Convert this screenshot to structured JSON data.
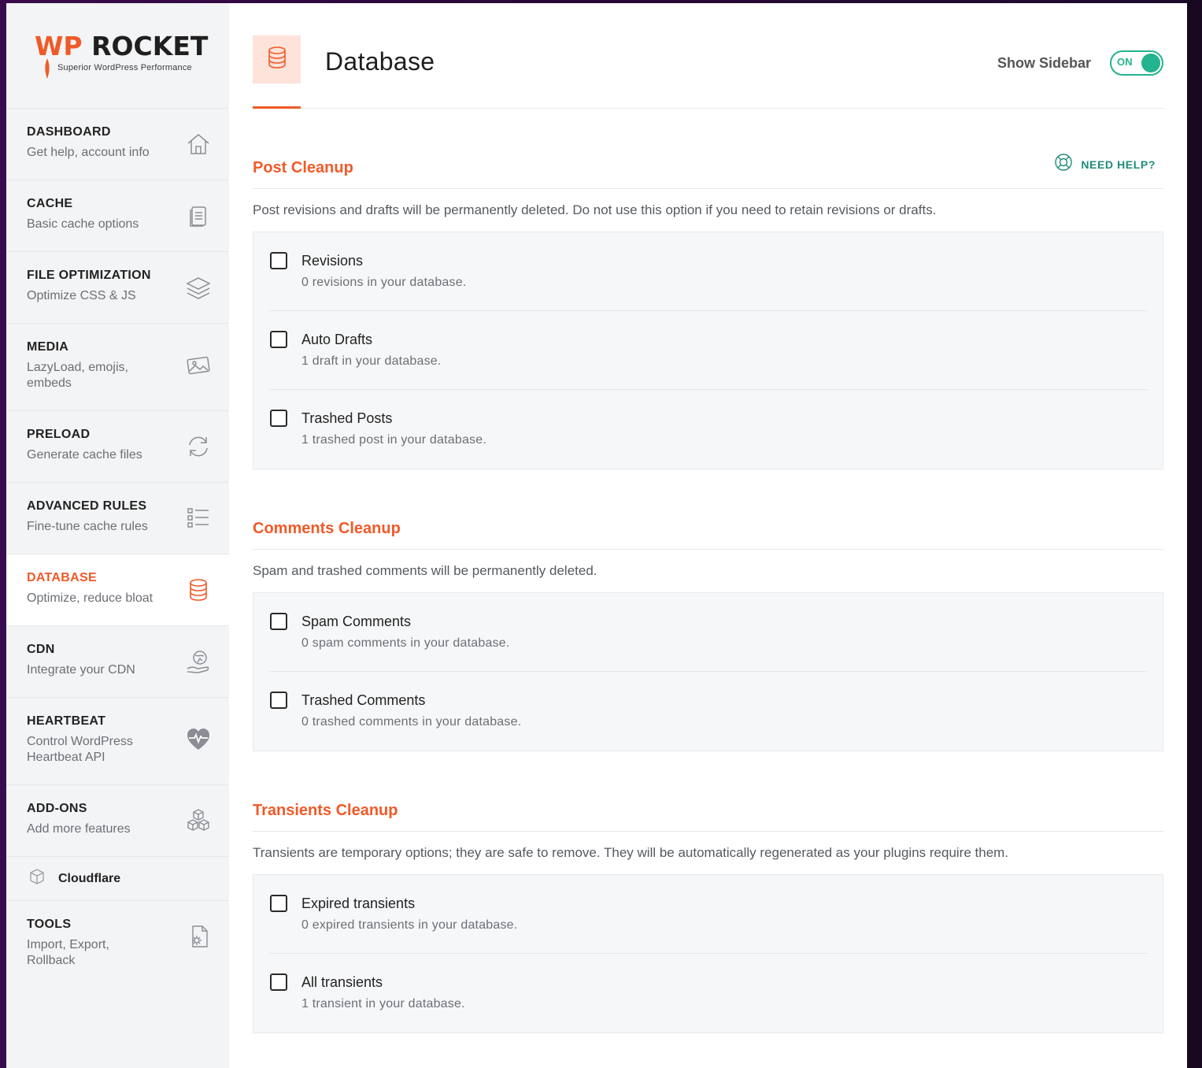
{
  "app": {
    "logo_brand_prefix": "WP",
    "logo_brand_rest": " ROCKET",
    "logo_tagline": "Superior WordPress Performance"
  },
  "colors": {
    "accent": "#f05a28",
    "toggle_on": "#23b38e",
    "help": "#1e8c7a"
  },
  "sidebar": {
    "items": [
      {
        "title": "DASHBOARD",
        "sub": "Get help, account info",
        "icon": "home-icon"
      },
      {
        "title": "CACHE",
        "sub": "Basic cache options",
        "icon": "file-icon"
      },
      {
        "title": "FILE OPTIMIZATION",
        "sub": "Optimize CSS & JS",
        "icon": "layers-icon"
      },
      {
        "title": "MEDIA",
        "sub": "LazyLoad, emojis, embeds",
        "icon": "image-icon"
      },
      {
        "title": "PRELOAD",
        "sub": "Generate cache files",
        "icon": "refresh-icon"
      },
      {
        "title": "ADVANCED RULES",
        "sub": "Fine-tune cache rules",
        "icon": "list-icon"
      },
      {
        "title": "DATABASE",
        "sub": "Optimize, reduce bloat",
        "icon": "database-icon",
        "active": true
      },
      {
        "title": "CDN",
        "sub": "Integrate your CDN",
        "icon": "globe-hand-icon"
      },
      {
        "title": "HEARTBEAT",
        "sub": "Control WordPress Heartbeat API",
        "icon": "heartbeat-icon"
      },
      {
        "title": "ADD-ONS",
        "sub": "Add more features",
        "icon": "cubes-icon"
      }
    ],
    "cloudflare_label": "Cloudflare",
    "tools": {
      "title": "TOOLS",
      "sub": "Import, Export, Rollback",
      "icon": "gear-file-icon"
    }
  },
  "header": {
    "title": "Database",
    "show_sidebar_label": "Show Sidebar",
    "toggle_state": "ON"
  },
  "sections": {
    "post": {
      "title": "Post Cleanup",
      "help": "NEED HELP?",
      "desc": "Post revisions and drafts will be permanently deleted. Do not use this option if you need to retain revisions or drafts.",
      "options": [
        {
          "title": "Revisions",
          "sub": "0 revisions in your database."
        },
        {
          "title": "Auto Drafts",
          "sub": "1 draft in your database."
        },
        {
          "title": "Trashed Posts",
          "sub": "1 trashed post in your database."
        }
      ]
    },
    "comments": {
      "title": "Comments Cleanup",
      "desc": "Spam and trashed comments will be permanently deleted.",
      "options": [
        {
          "title": "Spam Comments",
          "sub": "0 spam comments in your database."
        },
        {
          "title": "Trashed Comments",
          "sub": "0 trashed comments in your database."
        }
      ]
    },
    "transients": {
      "title": "Transients Cleanup",
      "desc": "Transients are temporary options; they are safe to remove. They will be automatically regenerated as your plugins require them.",
      "options": [
        {
          "title": "Expired transients",
          "sub": "0 expired transients in your database."
        },
        {
          "title": "All transients",
          "sub": "1 transient in your database."
        }
      ]
    }
  }
}
